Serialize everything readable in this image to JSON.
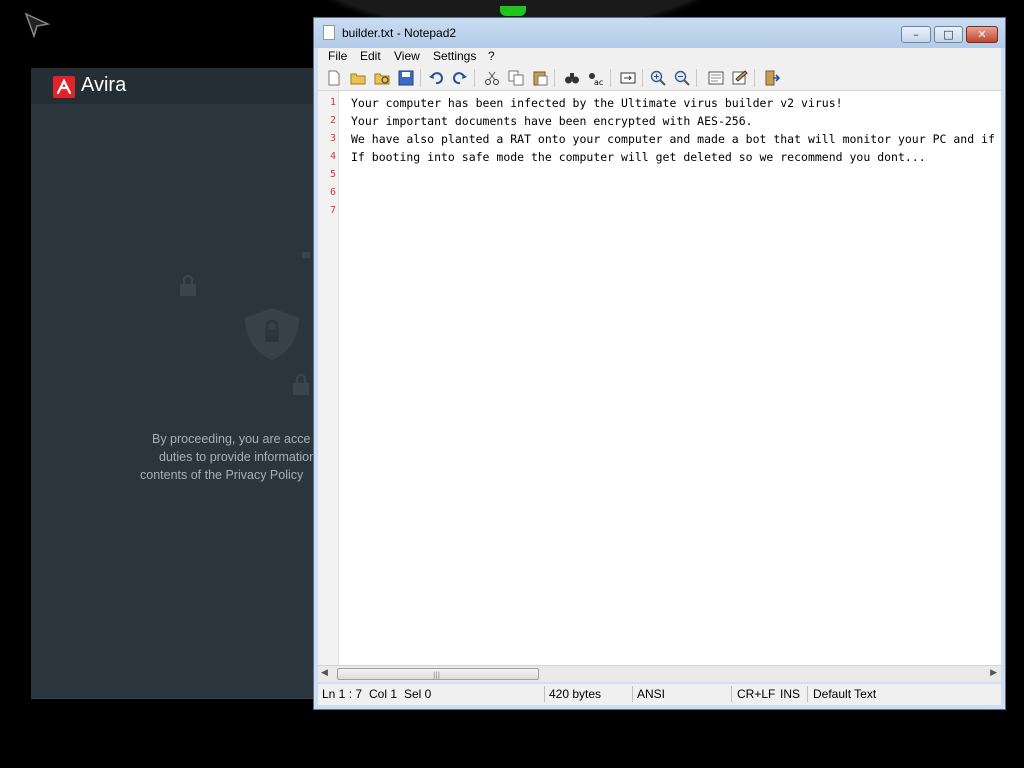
{
  "avira": {
    "name": "Avira",
    "consent_lines": [
      "By proceeding, you are acce",
      "duties to provide information",
      "contents of the Privacy Policy"
    ]
  },
  "notepad": {
    "title": "builder.txt - Notepad2",
    "window_buttons": {
      "minimize": "–",
      "maximize": "□",
      "close": "✕"
    },
    "menu": [
      "File",
      "Edit",
      "View",
      "Settings",
      "?"
    ],
    "lines": [
      "Your computer has been infected by the Ultimate virus builder v2 virus!",
      "Your important documents have been encrypted with AES-256.",
      "We have also planted a RAT onto your computer and made a bot that will monitor your PC and if",
      "If booting into safe mode the computer will get deleted so we recommend you dont...",
      "",
      "",
      ""
    ],
    "line_numbers": [
      "1",
      "2",
      "3",
      "4",
      "5",
      "6",
      "7"
    ],
    "status": {
      "position": "Ln 1 : 7",
      "column": "Col 1",
      "selection": "Sel 0",
      "size": "420 bytes",
      "encoding": "ANSI",
      "line_endings": "CR+LF",
      "mode": "INS",
      "scheme": "Default Text"
    },
    "scroll_arrows": {
      "left": "◀",
      "right": "▶",
      "grip": "|||"
    }
  },
  "colors": {
    "avira_red": "#e0222b",
    "avira_bg": "#2b353d",
    "notch_green": "#1ec51e",
    "line_number_red": "#dd3333"
  }
}
